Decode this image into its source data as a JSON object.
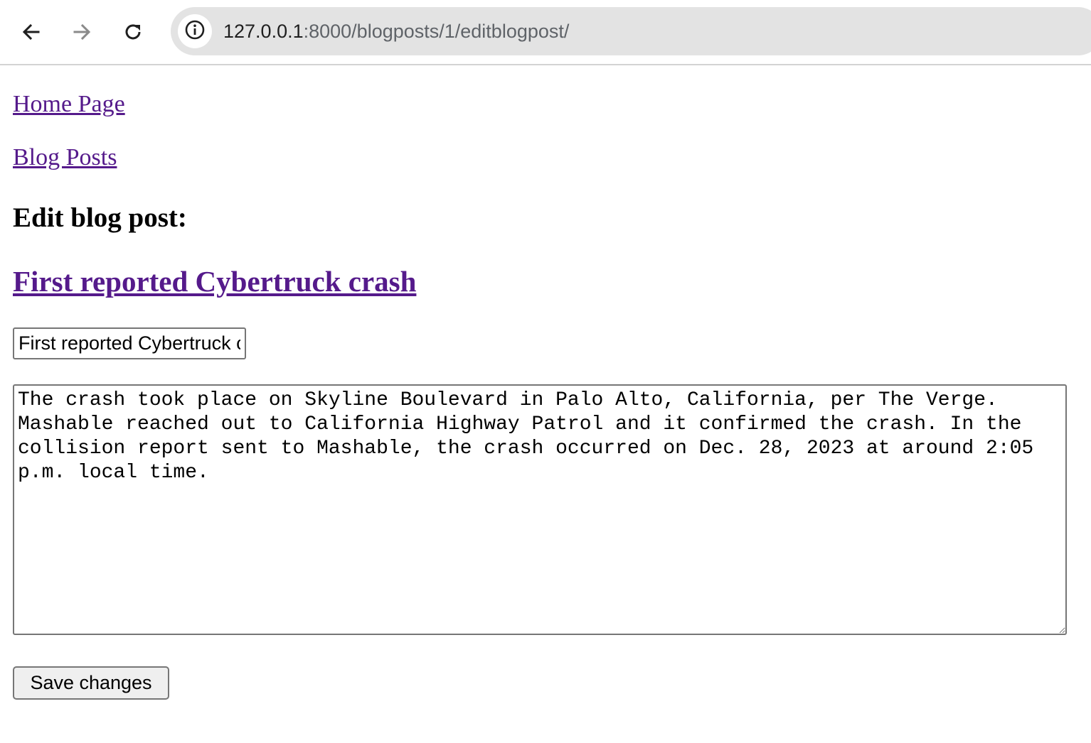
{
  "browser": {
    "url_host": "127.0.0.1",
    "url_rest": ":8000/blogposts/1/editblogpost/",
    "back_icon": "arrow-left-icon",
    "forward_icon": "arrow-right-icon",
    "reload_icon": "reload-icon",
    "site_info_icon": "info-circle-icon"
  },
  "nav": {
    "home_link": "Home Page",
    "blog_posts_link": "Blog Posts"
  },
  "main": {
    "heading": "Edit blog post:",
    "post_title_link": "First reported Cybertruck crash",
    "title_input_value": "First reported Cybertruck crash",
    "body_value": "The crash took place on Skyline Boulevard in Palo Alto, California, per The Verge. Mashable reached out to California Highway Patrol and it confirmed the crash. In the collision report sent to Mashable, the crash occurred on Dec. 28, 2023 at around 2:05 p.m. local time.",
    "save_button": "Save changes"
  },
  "colors": {
    "visited_link": "#551a8b",
    "omnibox_bg": "#e3e3e3",
    "button_bg": "#efefef"
  }
}
